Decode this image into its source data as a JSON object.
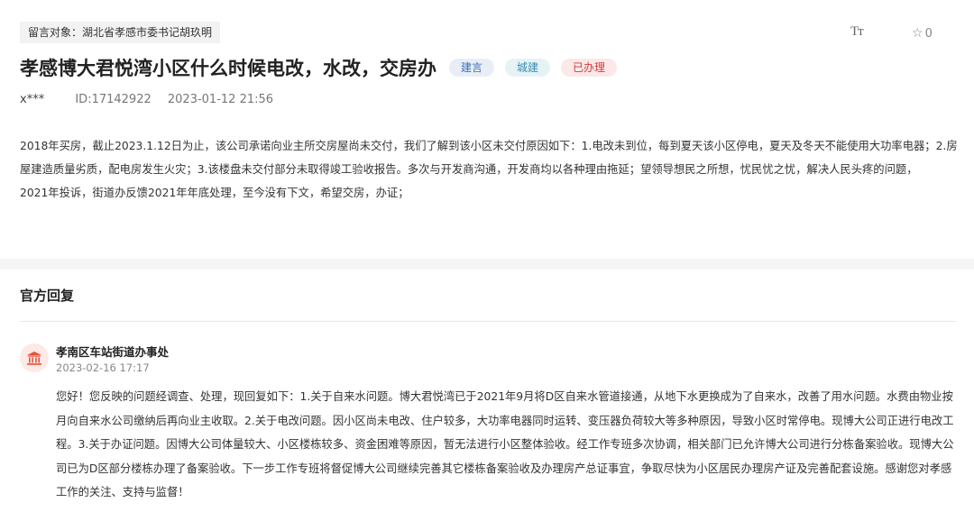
{
  "header": {
    "target_label": "留言对象：湖北省孝感市委书记胡玖明",
    "font_size_icon": "Tт",
    "favorite_count": "0"
  },
  "post": {
    "title": "孝感博大君悦湾小区什么时候电改，水改，交房办",
    "tags": [
      "建言",
      "城建",
      "已办理"
    ],
    "author": "x***",
    "id_text": "ID:17142922",
    "datetime": "2023-01-12 21:56",
    "paragraphs": [
      "2018年买房，截止2023.1.12日为止，该公司承诺向业主所交房屋尚未交付，我们了解到该小区未交付原因如下：1.电改未到位，每到夏天该小区停电，夏天及冬天不能使用大功率电器；2.房屋建造质量劣质，配电房发生火灾；3.该楼盘未交付部分未取得竣工验收报告。多次与开发商沟通，开发商均以各种理由拖延；望领导想民之所想，忧民忧之忧，解决人民头疼的问题，",
      "2021年投诉，街道办反馈2021年年底处理，至今没有下文，希望交房，办证；"
    ]
  },
  "reply": {
    "heading": "官方回复",
    "department": "孝南区车站街道办事处",
    "datetime": "2023-02-16 17:17",
    "content": "您好！您反映的问题经调查、处理，现回复如下：1.关于自来水问题。博大君悦湾已于2021年9月将D区自来水管道接通，从地下水更换成为了自来水，改善了用水问题。水费由物业按月向自来水公司缴纳后再向业主收取。2.关于电改问题。因小区尚未电改、住户较多，大功率电器同时运转、变压器负荷较大等多种原因，导致小区时常停电。现博大公司正进行电改工程。3.关于办证问题。因博大公司体量较大、小区楼栋较多、资金困难等原因，暂无法进行小区整体验收。经工作专班多次协调，相关部门已允许博大公司进行分栋备案验收。现博大公司已为D区部分楼栋办理了备案验收。下一步工作专班将督促博大公司继续完善其它楼栋备案验收及办理房产总证事宜，争取尽快为小区居民办理房产证及完善配套设施。感谢您对孝感工作的关注、支持与监督！"
  },
  "colors": {
    "tag_suggest": "#3c6fb8",
    "tag_construction": "#3b8db0",
    "tag_done": "#d03a3a",
    "avatar_icon": "#e0533d"
  }
}
